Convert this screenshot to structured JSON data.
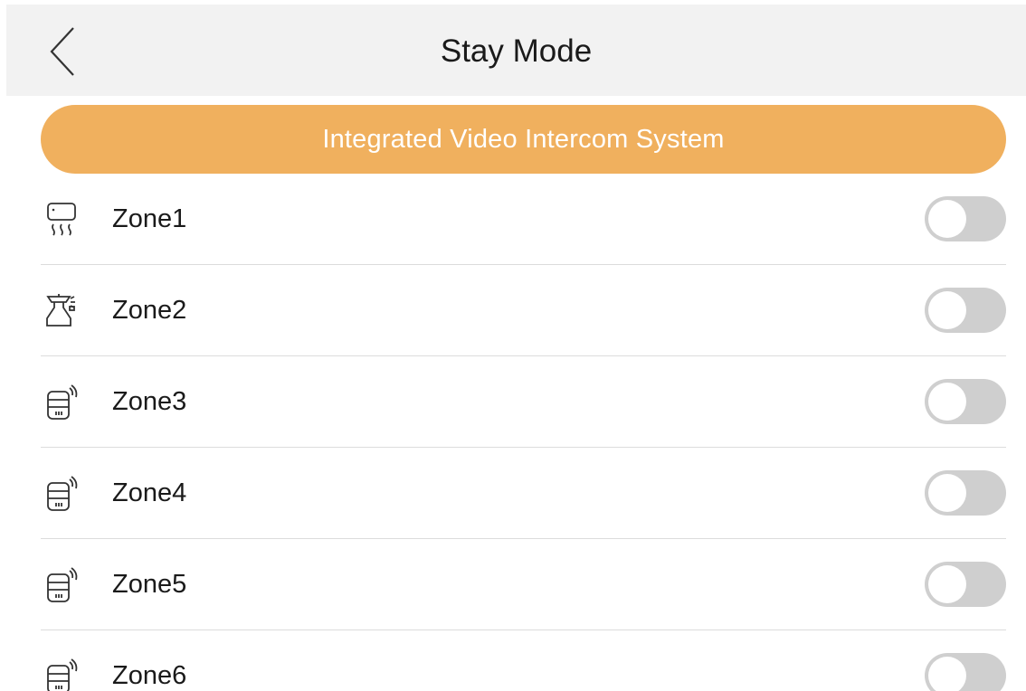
{
  "header": {
    "title": "Stay Mode",
    "back_icon": "chevron-left-icon"
  },
  "banner": {
    "label": "Integrated Video Intercom System",
    "color": "#f0b05e"
  },
  "zones": [
    {
      "label": "Zone1",
      "icon": "heat-detector-icon",
      "enabled": false
    },
    {
      "label": "Zone2",
      "icon": "smoke-detector-icon",
      "enabled": false
    },
    {
      "label": "Zone3",
      "icon": "wireless-detector-icon",
      "enabled": false
    },
    {
      "label": "Zone4",
      "icon": "wireless-detector-icon",
      "enabled": false
    },
    {
      "label": "Zone5",
      "icon": "wireless-detector-icon",
      "enabled": false
    },
    {
      "label": "Zone6",
      "icon": "wireless-detector-icon",
      "enabled": false
    }
  ],
  "colors": {
    "toggle_off": "#cfcfcf",
    "header_bg": "#f2f2f2"
  }
}
